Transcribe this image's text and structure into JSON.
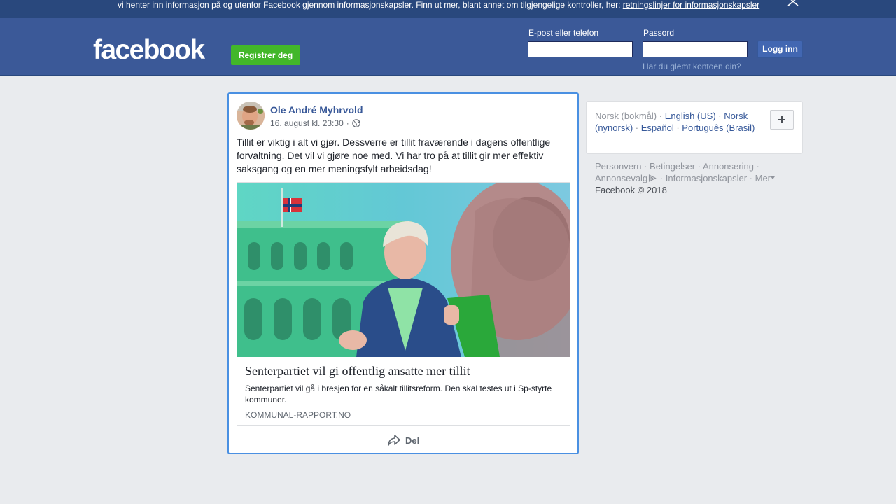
{
  "cookie_banner": {
    "text": "vi henter inn informasjon på og utenfor Facebook gjennom informasjonskapsler. Finn ut mer, blant annet om tilgjengelige kontroller, her: ",
    "link": "retningslinjer for informasjonskapsler"
  },
  "header": {
    "logo": "facebook",
    "register_label": "Registrer deg",
    "email_label": "E-post eller telefon",
    "password_label": "Passord",
    "email_value": "",
    "password_value": "",
    "login_label": "Logg inn",
    "forgot_label": "Har du glemt kontoen din?"
  },
  "post": {
    "author": "Ole André Myhrvold",
    "timestamp": "16. august kl. 23:30",
    "separator": "·",
    "privacy_icon": "globe-icon",
    "text": "Tillit er viktig i alt vi gjør. Dessverre er tillit fraværende i dagens offentlige forvaltning. Det vil vi gjøre noe med. Vi har tro på at tillit gir mer effektiv saksgang og en mer meningsfylt arbeidsdag!",
    "link": {
      "title": "Senterpartiet vil gi offentlig ansatte mer tillit",
      "description": "Senterpartiet vil gå i bresjen for en såkalt tillitsreform. Den skal testes ut i Sp-styrte kommuner.",
      "domain": "KOMMUNAL-RAPPORT.NO"
    },
    "share_label": "Del"
  },
  "languages": {
    "current": "Norsk (bokmål)",
    "options": [
      "English (US)",
      "Norsk (nynorsk)",
      "Español",
      "Português (Brasil)"
    ]
  },
  "footer": {
    "links": [
      "Personvern",
      "Betingelser",
      "Annonsering",
      "Annonsevalg",
      "Informasjonskapsler",
      "Mer"
    ],
    "copyright": "Facebook © 2018"
  },
  "colors": {
    "brand_blue": "#3b5998",
    "banner_blue": "#29487d",
    "register_green": "#42b72a",
    "link_blue": "#385898",
    "post_focus_border": "#4a90e2"
  }
}
